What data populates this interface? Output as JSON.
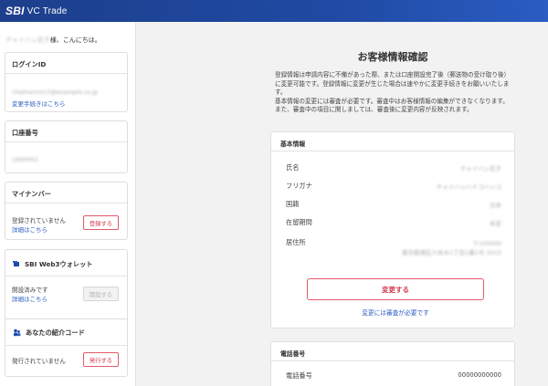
{
  "brand": {
    "sbi": "SBI",
    "name": "VC Trade"
  },
  "sidebar": {
    "greeting_name": "チャイハン花子",
    "greeting_suffix": "様、こんにちは。",
    "login": {
      "label": "ログインID",
      "value": "chaihanmin7@example.co.jp",
      "link": "変更手続きはこちら"
    },
    "account": {
      "label": "口座番号",
      "value": "1900001"
    },
    "mynumber": {
      "label": "マイナンバー",
      "status": "登録されていません",
      "link": "詳細はこちら",
      "button": "登録する"
    },
    "wallet": {
      "label": "SBI Web3ウォレット",
      "status": "開設済みです",
      "link": "詳細はこちら",
      "button": "開設する"
    },
    "referral": {
      "label": "あなたの紹介コード",
      "status": "発行されていません",
      "button": "発行する"
    }
  },
  "main": {
    "title": "お客様情報確認",
    "description": "登録情報は申請内容に不備があった際、または口座開設完了後（郵送物の受け取り後）に変更可能です。登録情報に変更が生じた場合は速やかに変更手続きをお願いいたします。\n基本情報の変更には審査が必要です。審査中はお客様情報の編集ができなくなります。また、審査中の項目に関しましては、審査後に変更内容が反映されます。",
    "basic": {
      "heading": "基本情報",
      "rows": [
        {
          "label": "氏名",
          "value": "チャイハン花子"
        },
        {
          "label": "フリガナ",
          "value": "チャイハンハナコハンコ"
        },
        {
          "label": "国籍",
          "value": "日本"
        },
        {
          "label": "在留期間",
          "value": "未定"
        },
        {
          "label": "居住所",
          "value": "〒100000",
          "value2": "東京都港区六本木1丁目1番1号 2012"
        }
      ],
      "change_button": "変更する",
      "review_link": "変更には審査が必要です"
    },
    "phone": {
      "heading": "電話番号",
      "label": "電話番号",
      "value": "00000000000"
    }
  },
  "colors": {
    "header": "#1f4aa3",
    "accent_red": "#d33a4c",
    "link_blue": "#2a5cc2"
  }
}
